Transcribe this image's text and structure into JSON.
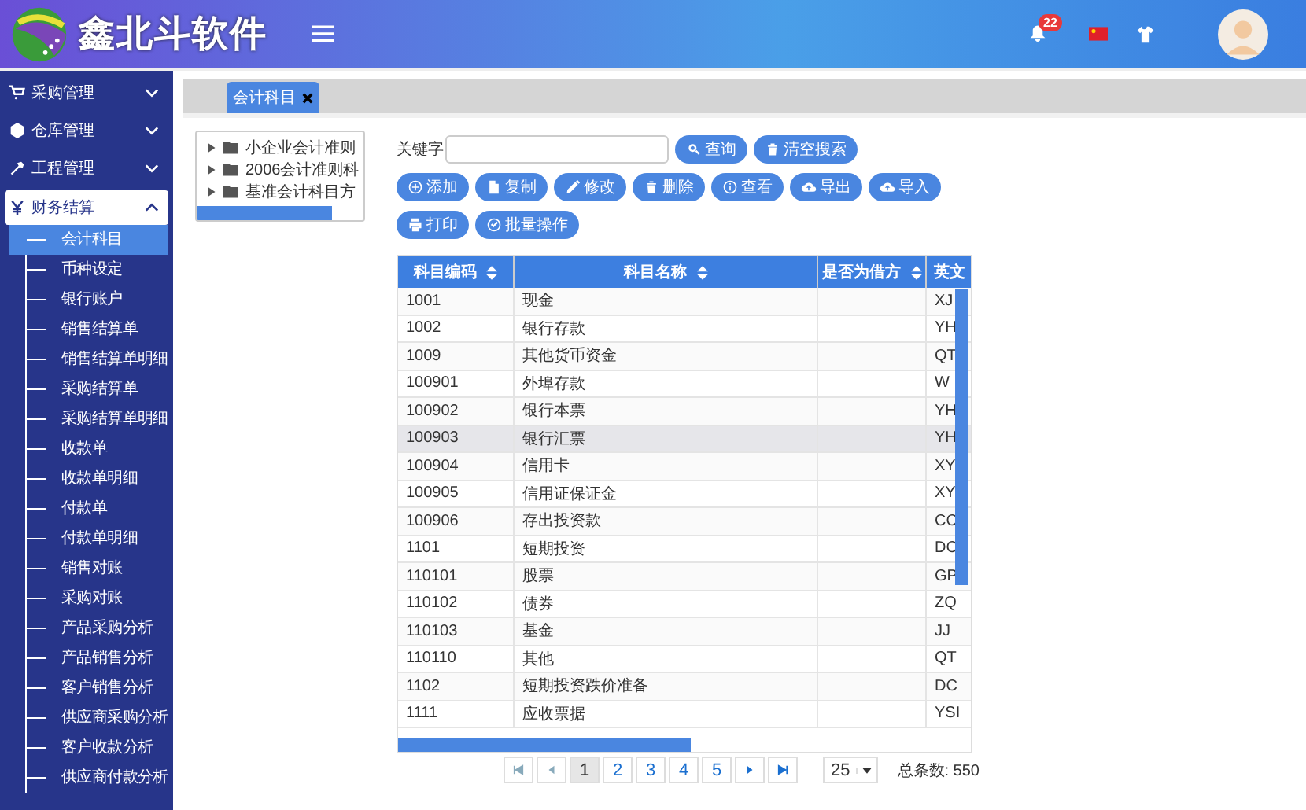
{
  "header": {
    "brand": "鑫北斗软件",
    "notification_count": "22"
  },
  "sidebar": {
    "items": [
      {
        "label": "采购管理",
        "expanded": false
      },
      {
        "label": "仓库管理",
        "expanded": false
      },
      {
        "label": "工程管理",
        "expanded": false
      },
      {
        "label": "财务结算",
        "expanded": true,
        "children": [
          {
            "label": "会计科目",
            "selected": true
          },
          {
            "label": "币种设定",
            "selected": false
          },
          {
            "label": "银行账户",
            "selected": false
          },
          {
            "label": "销售结算单",
            "selected": false
          },
          {
            "label": "销售结算单明细",
            "selected": false
          },
          {
            "label": "采购结算单",
            "selected": false
          },
          {
            "label": "采购结算单明细",
            "selected": false
          },
          {
            "label": "收款单",
            "selected": false
          },
          {
            "label": "收款单明细",
            "selected": false
          },
          {
            "label": "付款单",
            "selected": false
          },
          {
            "label": "付款单明细",
            "selected": false
          },
          {
            "label": "销售对账",
            "selected": false
          },
          {
            "label": "采购对账",
            "selected": false
          },
          {
            "label": "产品采购分析",
            "selected": false
          },
          {
            "label": "产品销售分析",
            "selected": false
          },
          {
            "label": "客户销售分析",
            "selected": false
          },
          {
            "label": "供应商采购分析",
            "selected": false
          },
          {
            "label": "客户收款分析",
            "selected": false
          },
          {
            "label": "供应商付款分析",
            "selected": false
          }
        ]
      }
    ]
  },
  "tabs": [
    {
      "label": "会计科目",
      "selected": true
    }
  ],
  "tree": [
    {
      "label": "小企业会计准则"
    },
    {
      "label": "2006会计准则科"
    },
    {
      "label": "基准会计科目方"
    }
  ],
  "search": {
    "label": "关键字"
  },
  "buttons": [
    {
      "label": "查询"
    },
    {
      "label": "清空搜索"
    },
    {
      "label": "添加"
    },
    {
      "label": "复制"
    },
    {
      "label": "修改"
    },
    {
      "label": "删除"
    },
    {
      "label": "查看"
    },
    {
      "label": "导出"
    },
    {
      "label": "导入"
    },
    {
      "label": "打印"
    },
    {
      "label": "批量操作"
    }
  ],
  "table": {
    "columns": [
      "科目编码",
      "科目名称",
      "是否为借方",
      "英文"
    ],
    "rows": [
      {
        "cells": [
          "1001",
          "现金",
          "",
          "XJ"
        ],
        "selected": false
      },
      {
        "cells": [
          "1002",
          "银行存款",
          "",
          "YH"
        ],
        "selected": false
      },
      {
        "cells": [
          "1009",
          "其他货币资金",
          "",
          "QT"
        ],
        "selected": false
      },
      {
        "cells": [
          "100901",
          "外埠存款",
          "",
          "W"
        ],
        "selected": false
      },
      {
        "cells": [
          "100902",
          "银行本票",
          "",
          "YH"
        ],
        "selected": false
      },
      {
        "cells": [
          "100903",
          "银行汇票",
          "",
          "YH"
        ],
        "selected": true
      },
      {
        "cells": [
          "100904",
          "信用卡",
          "",
          "XY"
        ],
        "selected": false
      },
      {
        "cells": [
          "100905",
          "信用证保证金",
          "",
          "XY"
        ],
        "selected": false
      },
      {
        "cells": [
          "100906",
          "存出投资款",
          "",
          "CC"
        ],
        "selected": false
      },
      {
        "cells": [
          "1101",
          "短期投资",
          "",
          "DC"
        ],
        "selected": false
      },
      {
        "cells": [
          "110101",
          "股票",
          "",
          "GP"
        ],
        "selected": false
      },
      {
        "cells": [
          "110102",
          "债券",
          "",
          "ZQ"
        ],
        "selected": false
      },
      {
        "cells": [
          "110103",
          "基金",
          "",
          "JJ"
        ],
        "selected": false
      },
      {
        "cells": [
          "110110",
          "其他",
          "",
          "QT"
        ],
        "selected": false
      },
      {
        "cells": [
          "1102",
          "短期投资跌价准备",
          "",
          "DC"
        ],
        "selected": false
      },
      {
        "cells": [
          "1111",
          "应收票据",
          "",
          "YSI"
        ],
        "selected": false
      }
    ]
  },
  "pagination": {
    "pages": [
      {
        "label": "1",
        "selected": true
      },
      {
        "label": "2",
        "selected": false
      },
      {
        "label": "3",
        "selected": false
      },
      {
        "label": "4",
        "selected": false
      },
      {
        "label": "5",
        "selected": false
      }
    ],
    "page_size": "25",
    "total": "总条数: 550"
  }
}
